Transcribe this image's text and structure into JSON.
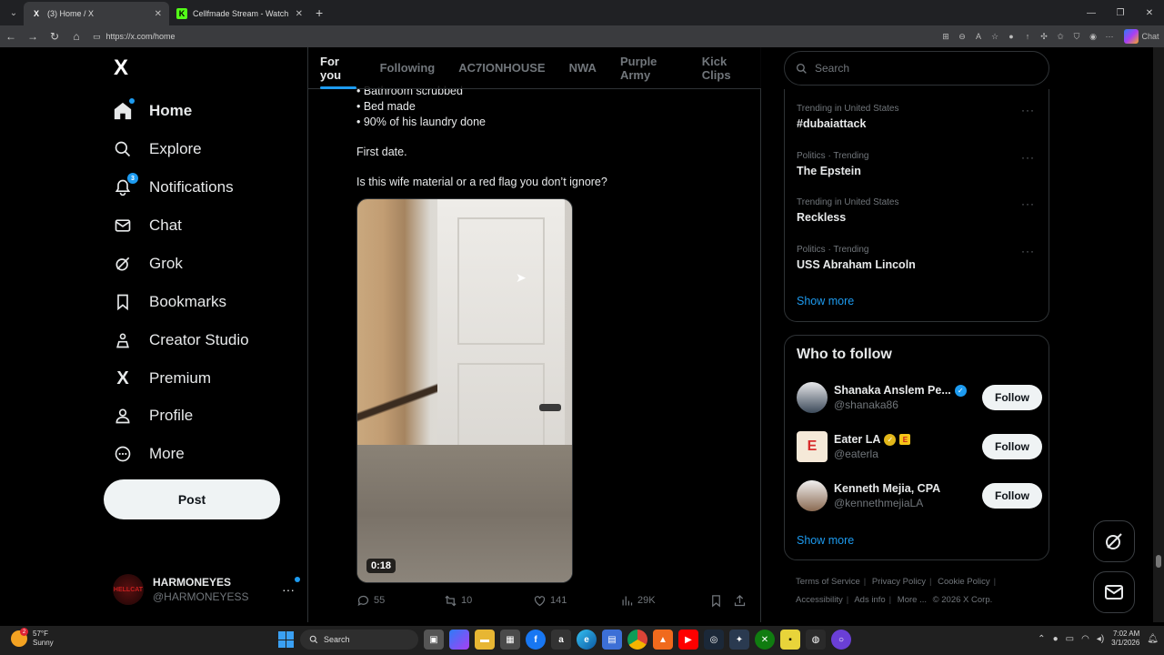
{
  "browser": {
    "tabs": [
      {
        "title": "(3) Home / X",
        "favicon": "X"
      },
      {
        "title": "Cellfmade Stream - Watch Live on",
        "favicon": "K"
      }
    ],
    "url": "https://x.com/home",
    "chat_label": "Chat"
  },
  "sidebar": {
    "logo": "X",
    "nav": [
      {
        "label": "Home",
        "icon": "home-icon"
      },
      {
        "label": "Explore",
        "icon": "search-icon"
      },
      {
        "label": "Notifications",
        "icon": "bell-icon",
        "badge": "3"
      },
      {
        "label": "Chat",
        "icon": "mail-icon"
      },
      {
        "label": "Grok",
        "icon": "grok-icon"
      },
      {
        "label": "Bookmarks",
        "icon": "bookmark-icon"
      },
      {
        "label": "Creator Studio",
        "icon": "creator-icon"
      },
      {
        "label": "Premium",
        "icon": "x-icon"
      },
      {
        "label": "Profile",
        "icon": "person-icon"
      },
      {
        "label": "More",
        "icon": "more-circle-icon"
      }
    ],
    "post_label": "Post",
    "account": {
      "name": "HARMONEYES",
      "handle": "@HARMONEYESS",
      "avatar_text": "HELLCAT"
    }
  },
  "timeline": {
    "tabs": [
      "For you",
      "Following",
      "AC7IONHOUSE",
      "NWA",
      "Purple Army",
      "Kick Clips"
    ],
    "tweet": {
      "lines": [
        "• Bathroom scrubbed",
        "• Bed made",
        "• 90% of his laundry done"
      ],
      "para1": "First date.",
      "para2": "Is this wife material or a red flag you don’t ignore?",
      "video_duration": "0:18",
      "replies": "55",
      "reposts": "10",
      "likes": "141",
      "views": "29K"
    }
  },
  "right": {
    "search_placeholder": "Search",
    "trends": [
      {
        "context": "Trending in United States",
        "name": "#dubaiattack"
      },
      {
        "context": "Politics · Trending",
        "name": "The Epstein"
      },
      {
        "context": "Trending in United States",
        "name": "Reckless"
      },
      {
        "context": "Politics · Trending",
        "name": "USS Abraham Lincoln"
      }
    ],
    "show_more": "Show more",
    "who_to_follow": {
      "title": "Who to follow",
      "users": [
        {
          "name": "Shanaka Anslem Pe...",
          "handle": "@shanaka86",
          "follow": "Follow"
        },
        {
          "name": "Eater LA",
          "handle": "@eaterla",
          "follow": "Follow",
          "avatar_letter": "E"
        },
        {
          "name": "Kenneth Mejia, CPA",
          "handle": "@kennethmejiaLA",
          "follow": "Follow"
        }
      ],
      "show_more": "Show more"
    },
    "footer": [
      "Terms of Service",
      "Privacy Policy",
      "Cookie Policy",
      "Accessibility",
      "Ads info",
      "More ...",
      "© 2026 X Corp."
    ]
  },
  "taskbar": {
    "weather_temp": "57°F",
    "weather_cond": "Sunny",
    "weather_badge": "2",
    "search_label": "Search",
    "time": "7:02 AM",
    "date": "3/1/2026"
  },
  "colors": {
    "accent": "#1d9bf0",
    "background": "#000000",
    "text": "#e7e9ea",
    "muted": "#71767b"
  }
}
